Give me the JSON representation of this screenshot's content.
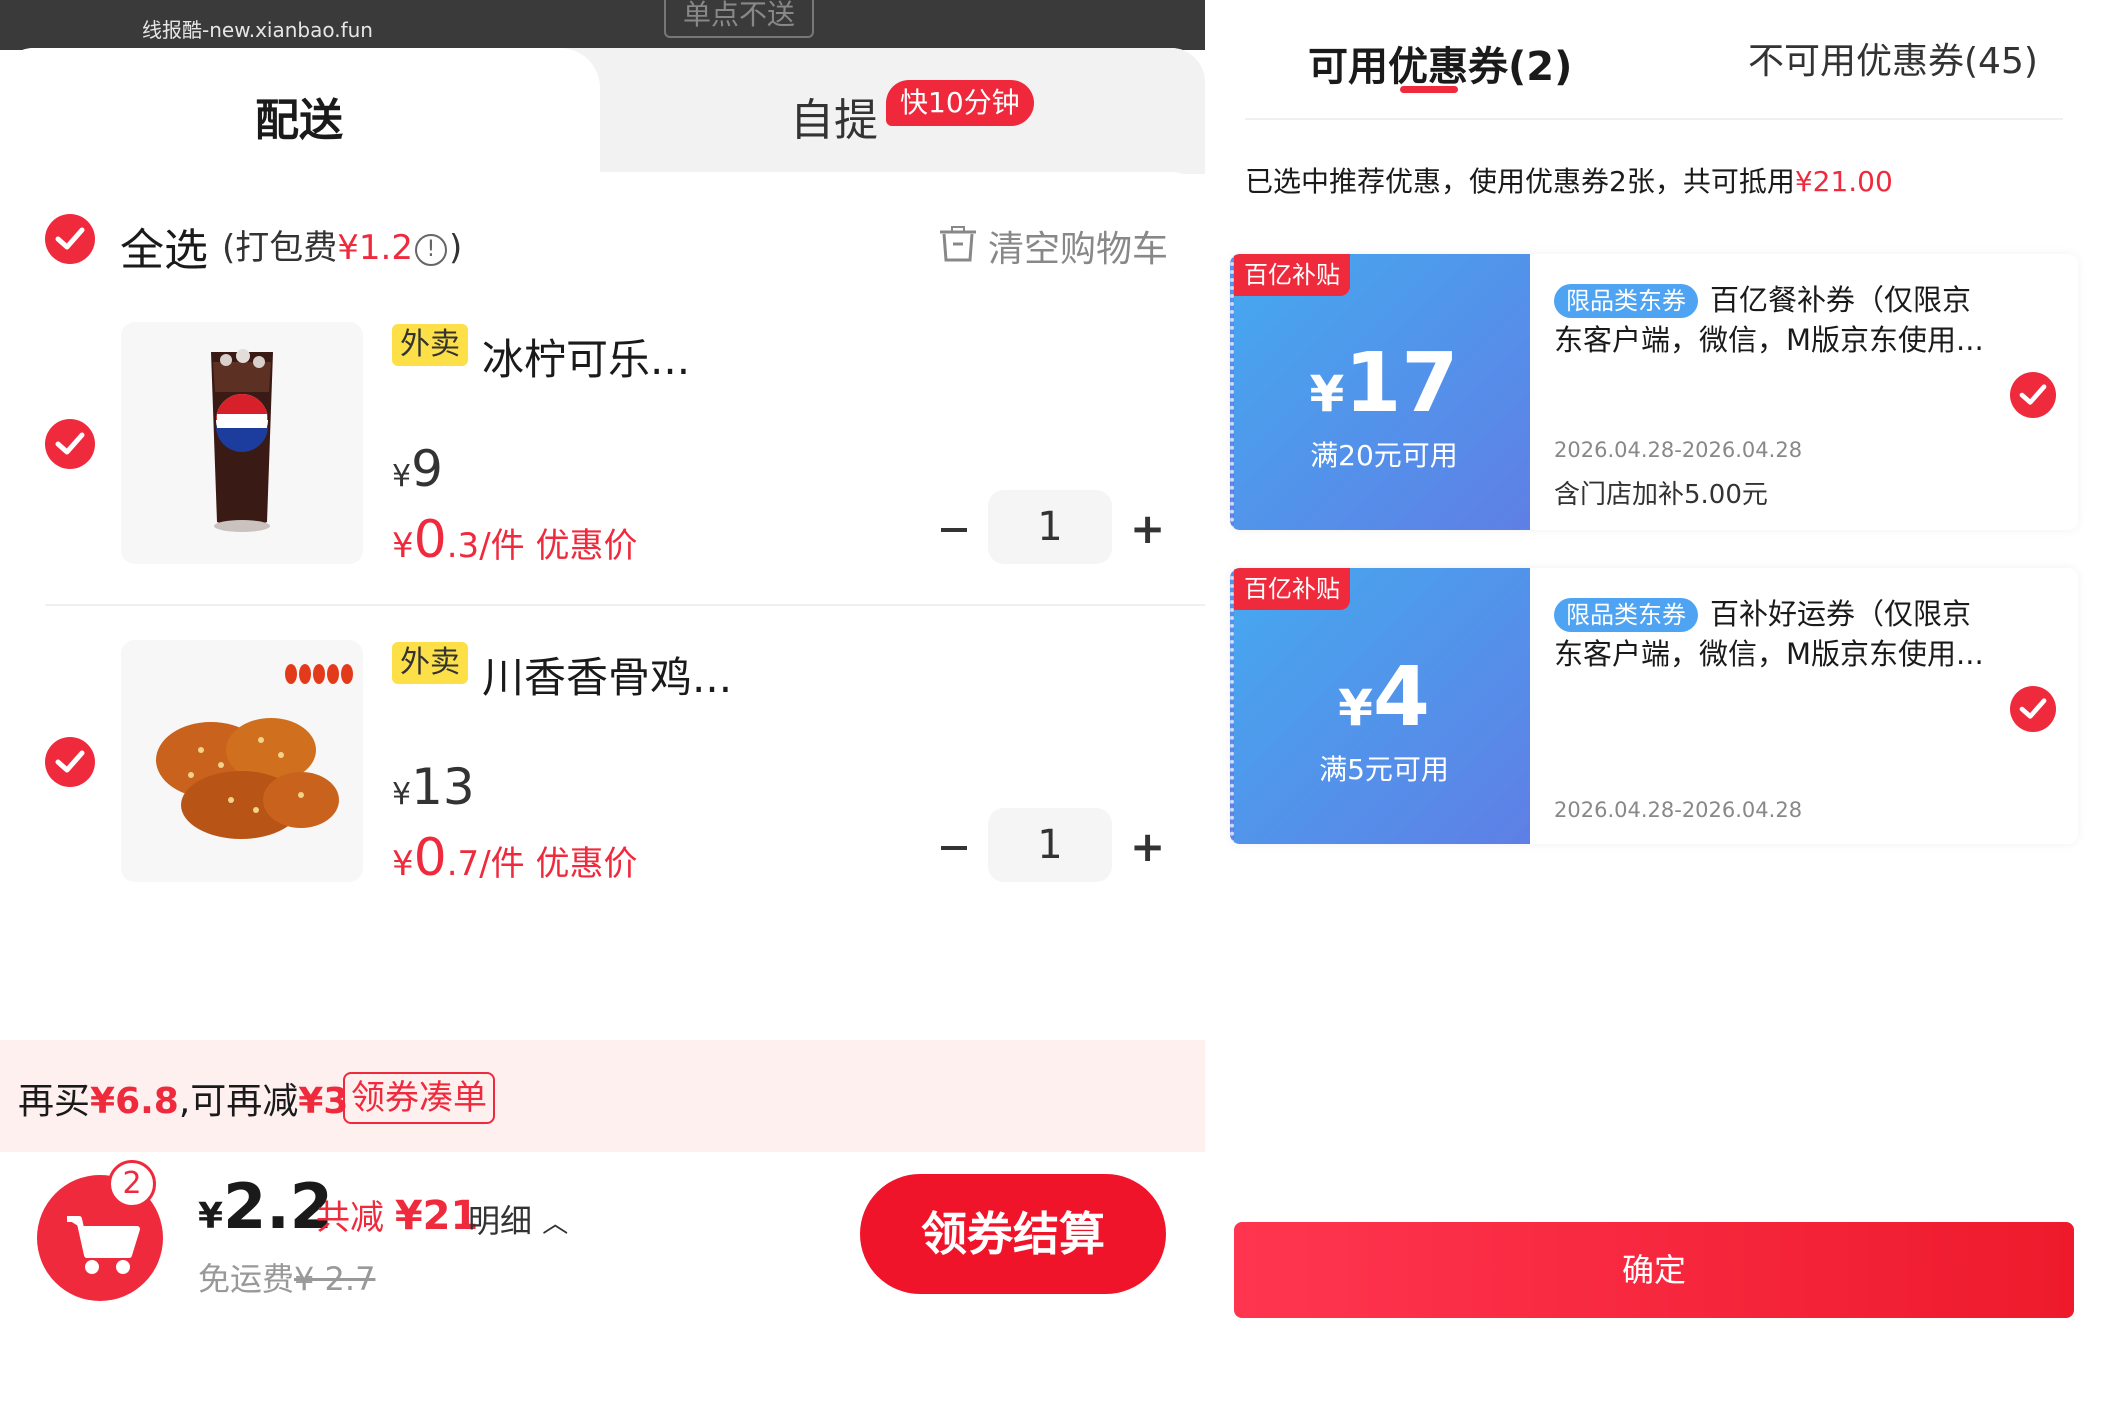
{
  "watermark": "线报酷-new.xianbao.fun",
  "top_note": "单点不送",
  "tabs": {
    "delivery": "配送",
    "pickup": "自提",
    "pickup_badge": "快10分钟"
  },
  "cart": {
    "select_all": "全选",
    "packing_fee_prefix": "(打包费",
    "packing_fee": "¥1.2",
    "packing_fee_suffix": ")",
    "info_icon": "!",
    "clear_cart": "清空购物车",
    "items": [
      {
        "tag": "外卖",
        "name": "冰柠可乐...",
        "original_price": "9",
        "currency": "¥",
        "deal_int": "0",
        "deal_dec": ".3",
        "deal_unit": "/件",
        "deal_label": "优惠价",
        "qty": "1",
        "image": "cola-cup"
      },
      {
        "tag": "外卖",
        "name": "川香香骨鸡...",
        "original_price": "13",
        "currency": "¥",
        "deal_int": "0",
        "deal_dec": ".7",
        "deal_unit": "/件",
        "deal_label": "优惠价",
        "qty": "1",
        "image": "chicken-wings"
      }
    ],
    "qty_minus": "−",
    "qty_plus": "+"
  },
  "promo": {
    "text_a": "再买",
    "amount_more": "¥6.8",
    "text_b": ",可再减",
    "amount_off": "¥3",
    "button": "领券凑单"
  },
  "footer": {
    "cart_count": "2",
    "currency": "¥",
    "total": "2.2",
    "saved_label": "共减",
    "saved_amount": "¥21",
    "detail": "明细",
    "free_ship": "免运费",
    "ship_old": "¥ 2.7",
    "checkout": "领券结算"
  },
  "coupons_panel": {
    "tab_available": "可用优惠券(2)",
    "tab_unavailable": "不可用优惠券(45)",
    "note_prefix": "已选中推荐优惠，使用优惠券2张，共可抵用",
    "note_amount": "¥21.00",
    "coupons": [
      {
        "badge": "百亿补贴",
        "currency": "¥",
        "amount": "17",
        "condition": "满20元可用",
        "tag": "限品类东券",
        "title": "百亿餐补券（仅限京东客户端，微信，M版京东使用...",
        "date": "2026.04.28-2026.04.28",
        "extra": "含门店加补5.00元"
      },
      {
        "badge": "百亿补贴",
        "currency": "¥",
        "amount": "4",
        "condition": "满5元可用",
        "tag": "限品类东券",
        "title": "百补好运券（仅限京东客户端，微信，M版京东使用...",
        "date": "2026.04.28-2026.04.28",
        "extra": ""
      }
    ],
    "confirm": "确定"
  },
  "colors": {
    "accent_red": "#ef2a3d",
    "coupon_blue": "#5a8ee8",
    "tag_yellow": "#fde047"
  }
}
